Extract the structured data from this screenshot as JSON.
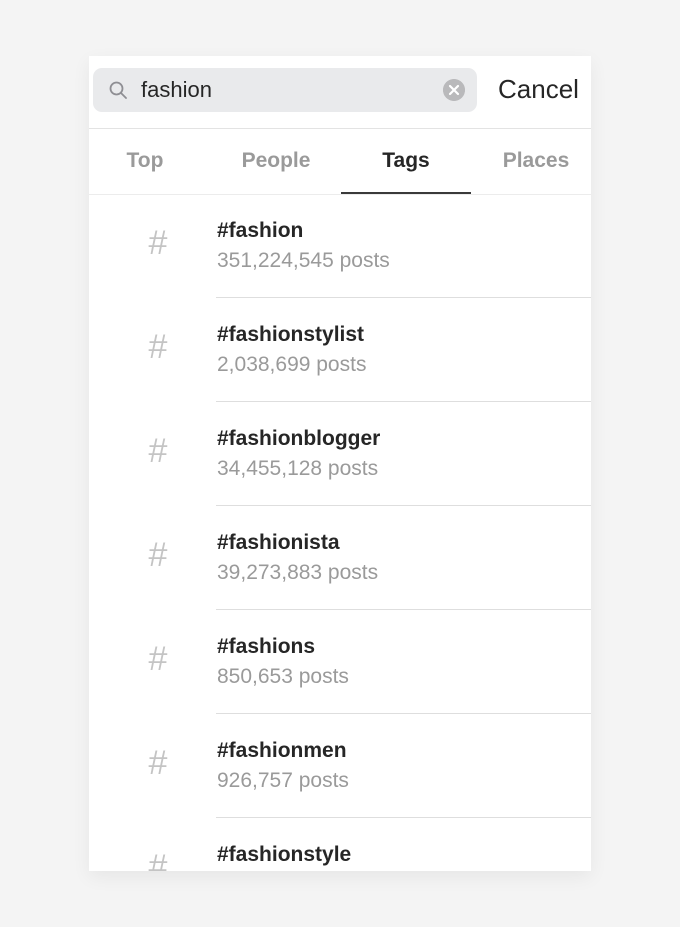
{
  "search": {
    "value": "fashion",
    "cancel_label": "Cancel"
  },
  "tabs": [
    {
      "label": "Top",
      "active": false
    },
    {
      "label": "People",
      "active": false
    },
    {
      "label": "Tags",
      "active": true
    },
    {
      "label": "Places",
      "active": false
    }
  ],
  "results": [
    {
      "icon": "hashtag-icon",
      "title": "#fashion",
      "count": "351,224,545 posts"
    },
    {
      "icon": "hashtag-icon",
      "title": "#fashionstylist",
      "count": "2,038,699 posts"
    },
    {
      "icon": "hashtag-icon",
      "title": "#fashionblogger",
      "count": "34,455,128 posts"
    },
    {
      "icon": "hashtag-icon",
      "title": "#fashionista",
      "count": "39,273,883 posts"
    },
    {
      "icon": "hashtag-icon",
      "title": "#fashions",
      "count": "850,653 posts"
    },
    {
      "icon": "hashtag-icon",
      "title": "#fashionmen",
      "count": "926,757 posts"
    },
    {
      "icon": "hashtag-icon",
      "title": "#fashionstyle",
      "count": ""
    }
  ]
}
